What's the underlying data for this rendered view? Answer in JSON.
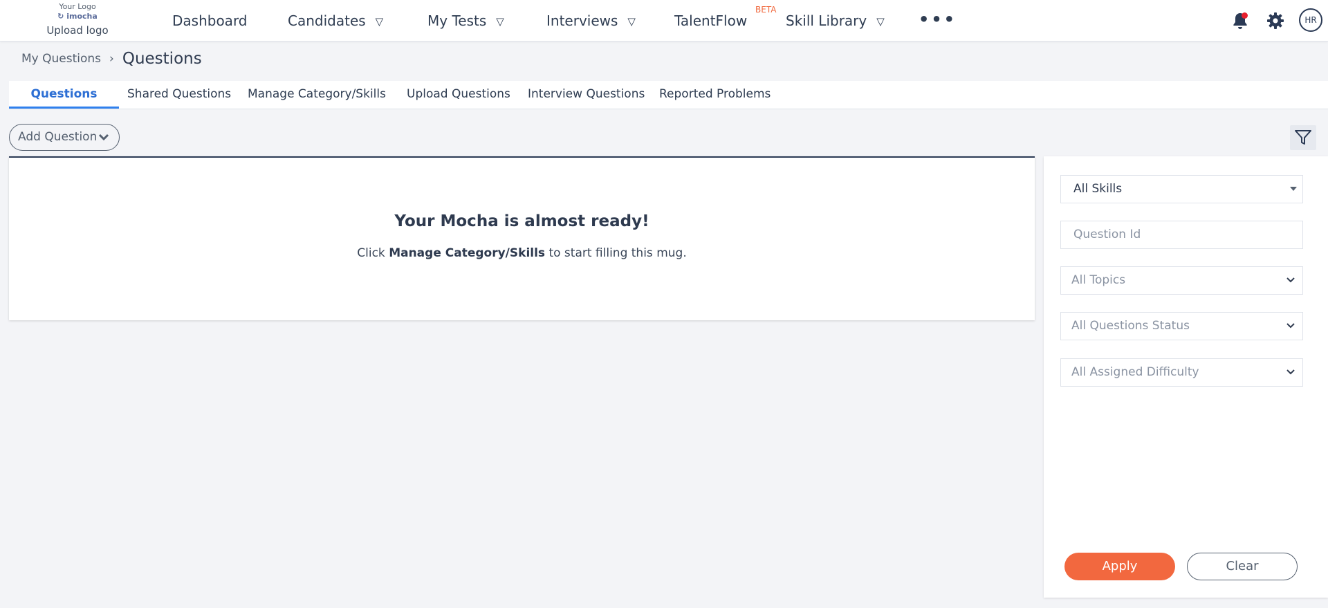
{
  "logo": {
    "placeholder_text": "Your Logo",
    "brand": "imocha",
    "upload_label": "Upload logo"
  },
  "nav": {
    "items": [
      {
        "label": "Dashboard",
        "has_caret": false
      },
      {
        "label": "Candidates",
        "has_caret": true
      },
      {
        "label": "My Tests",
        "has_caret": true
      },
      {
        "label": "Interviews",
        "has_caret": true
      },
      {
        "label": "TalentFlow",
        "has_caret": false
      },
      {
        "label": "Skill Library",
        "has_caret": true
      }
    ],
    "beta_badge": "BETA",
    "more_label": "•••",
    "caret_glyph": "▽",
    "avatar_initials": "HR",
    "notification_dot_color": "#e8202e"
  },
  "breadcrumb": {
    "parent": "My Questions",
    "separator": "›",
    "current": "Questions"
  },
  "tabs": [
    {
      "label": "Questions",
      "active": true
    },
    {
      "label": "Shared Questions",
      "active": false
    },
    {
      "label": "Manage Category/Skills",
      "active": false
    },
    {
      "label": "Upload Questions",
      "active": false
    },
    {
      "label": "Interview Questions",
      "active": false
    },
    {
      "label": "Reported Problems",
      "active": false
    }
  ],
  "toolbar": {
    "add_question_label": "Add Question"
  },
  "empty_state": {
    "title": "Your Mocha is almost ready!",
    "prefix": "Click",
    "link": "Manage Category/Skills",
    "suffix": "to start filling this mug."
  },
  "filters": {
    "skills_value": "All Skills",
    "question_id_placeholder": "Question Id",
    "topics_value": "All Topics",
    "status_value": "All Questions Status",
    "difficulty_value": "All Assigned Difficulty",
    "apply_label": "Apply",
    "clear_label": "Clear"
  },
  "colors": {
    "accent": "#2f80ed",
    "apply": "#f2683f",
    "beta": "#f0683d",
    "dark": "#2b3a55"
  }
}
